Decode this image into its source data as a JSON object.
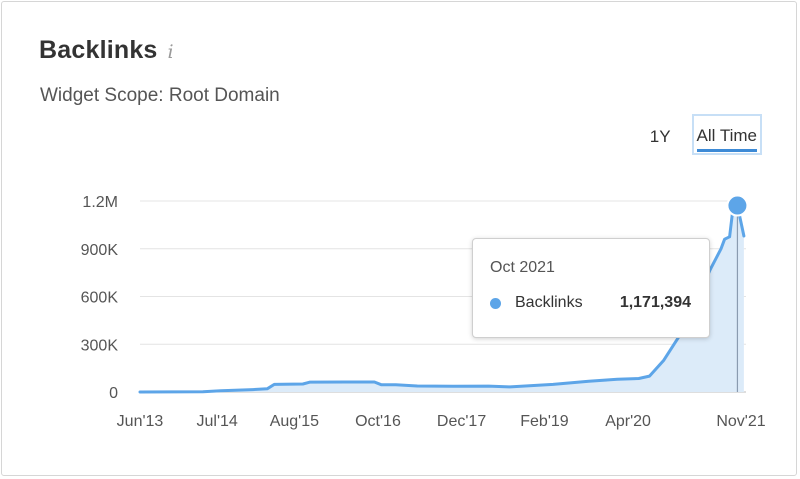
{
  "widget": {
    "title": "Backlinks",
    "info_glyph": "i",
    "subtitle": "Widget Scope: Root Domain",
    "tabs": [
      {
        "label": "1Y",
        "active": false
      },
      {
        "label": "All Time",
        "active": true
      }
    ],
    "accent_color": "#5da5e8",
    "area_color": "#dcebf9",
    "icon": "info-icon"
  },
  "tooltip": {
    "date": "Oct 2021",
    "series": "Backlinks",
    "value": "1,171,394"
  },
  "chart_data": {
    "type": "area",
    "series": [
      {
        "name": "Backlinks",
        "values": [
          [
            2013.42,
            0
          ],
          [
            2014.3,
            2000
          ],
          [
            2014.55,
            8000
          ],
          [
            2014.8,
            12000
          ],
          [
            2015.0,
            15000
          ],
          [
            2015.2,
            20000
          ],
          [
            2015.3,
            48000
          ],
          [
            2015.7,
            50000
          ],
          [
            2015.8,
            62000
          ],
          [
            2016.3,
            63000
          ],
          [
            2016.7,
            63000
          ],
          [
            2016.8,
            45000
          ],
          [
            2017.0,
            46000
          ],
          [
            2017.3,
            38000
          ],
          [
            2017.8,
            36000
          ],
          [
            2018.3,
            37000
          ],
          [
            2018.6,
            32000
          ],
          [
            2019.2,
            48000
          ],
          [
            2019.7,
            68000
          ],
          [
            2020.1,
            80000
          ],
          [
            2020.4,
            85000
          ],
          [
            2020.55,
            100000
          ],
          [
            2020.75,
            200000
          ],
          [
            2020.95,
            340000
          ],
          [
            2021.1,
            470000
          ],
          [
            2021.25,
            620000
          ],
          [
            2021.4,
            770000
          ],
          [
            2021.55,
            900000
          ],
          [
            2021.6,
            960000
          ],
          [
            2021.67,
            975000
          ],
          [
            2021.72,
            1160000
          ],
          [
            2021.75,
            1171394
          ],
          [
            2021.78,
            1171394
          ],
          [
            2021.87,
            980000
          ]
        ]
      }
    ],
    "x_tick_labels": [
      "Jun'13",
      "Jul'14",
      "Aug'15",
      "Oct'16",
      "Dec'17",
      "Feb'19",
      "Apr'20",
      "Nov'21"
    ],
    "x_tick_values": [
      2013.42,
      2014.5,
      2015.58,
      2016.75,
      2017.92,
      2019.08,
      2020.25,
      2021.83
    ],
    "y_tick_labels": [
      "0",
      "300K",
      "600K",
      "900K",
      "1.2M"
    ],
    "y_tick_values": [
      0,
      300000,
      600000,
      900000,
      1200000
    ],
    "xlim": [
      2013.42,
      2021.9
    ],
    "ylim": [
      0,
      1200000
    ],
    "highlight": {
      "x": 2021.78,
      "y": 1171394
    },
    "grid": true,
    "legend": "none"
  }
}
